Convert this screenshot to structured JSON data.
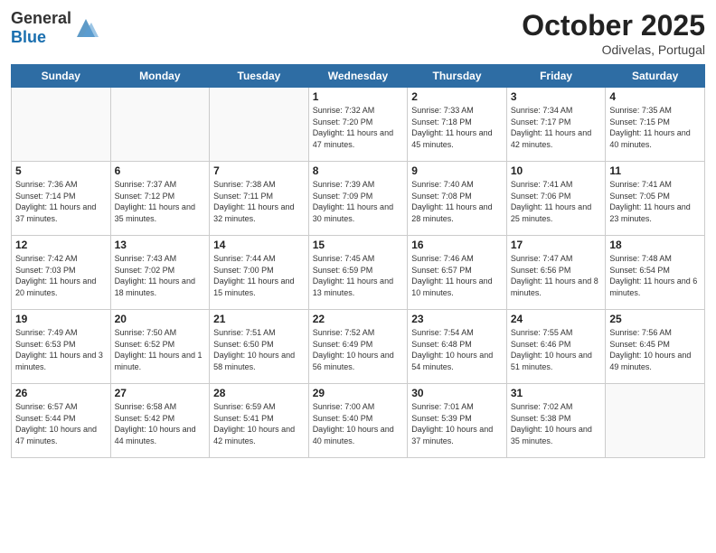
{
  "header": {
    "logo_general": "General",
    "logo_blue": "Blue",
    "title": "October 2025",
    "subtitle": "Odivelas, Portugal"
  },
  "days_of_week": [
    "Sunday",
    "Monday",
    "Tuesday",
    "Wednesday",
    "Thursday",
    "Friday",
    "Saturday"
  ],
  "weeks": [
    [
      {
        "day": "",
        "info": ""
      },
      {
        "day": "",
        "info": ""
      },
      {
        "day": "",
        "info": ""
      },
      {
        "day": "1",
        "info": "Sunrise: 7:32 AM\nSunset: 7:20 PM\nDaylight: 11 hours and 47 minutes."
      },
      {
        "day": "2",
        "info": "Sunrise: 7:33 AM\nSunset: 7:18 PM\nDaylight: 11 hours and 45 minutes."
      },
      {
        "day": "3",
        "info": "Sunrise: 7:34 AM\nSunset: 7:17 PM\nDaylight: 11 hours and 42 minutes."
      },
      {
        "day": "4",
        "info": "Sunrise: 7:35 AM\nSunset: 7:15 PM\nDaylight: 11 hours and 40 minutes."
      }
    ],
    [
      {
        "day": "5",
        "info": "Sunrise: 7:36 AM\nSunset: 7:14 PM\nDaylight: 11 hours and 37 minutes."
      },
      {
        "day": "6",
        "info": "Sunrise: 7:37 AM\nSunset: 7:12 PM\nDaylight: 11 hours and 35 minutes."
      },
      {
        "day": "7",
        "info": "Sunrise: 7:38 AM\nSunset: 7:11 PM\nDaylight: 11 hours and 32 minutes."
      },
      {
        "day": "8",
        "info": "Sunrise: 7:39 AM\nSunset: 7:09 PM\nDaylight: 11 hours and 30 minutes."
      },
      {
        "day": "9",
        "info": "Sunrise: 7:40 AM\nSunset: 7:08 PM\nDaylight: 11 hours and 28 minutes."
      },
      {
        "day": "10",
        "info": "Sunrise: 7:41 AM\nSunset: 7:06 PM\nDaylight: 11 hours and 25 minutes."
      },
      {
        "day": "11",
        "info": "Sunrise: 7:41 AM\nSunset: 7:05 PM\nDaylight: 11 hours and 23 minutes."
      }
    ],
    [
      {
        "day": "12",
        "info": "Sunrise: 7:42 AM\nSunset: 7:03 PM\nDaylight: 11 hours and 20 minutes."
      },
      {
        "day": "13",
        "info": "Sunrise: 7:43 AM\nSunset: 7:02 PM\nDaylight: 11 hours and 18 minutes."
      },
      {
        "day": "14",
        "info": "Sunrise: 7:44 AM\nSunset: 7:00 PM\nDaylight: 11 hours and 15 minutes."
      },
      {
        "day": "15",
        "info": "Sunrise: 7:45 AM\nSunset: 6:59 PM\nDaylight: 11 hours and 13 minutes."
      },
      {
        "day": "16",
        "info": "Sunrise: 7:46 AM\nSunset: 6:57 PM\nDaylight: 11 hours and 10 minutes."
      },
      {
        "day": "17",
        "info": "Sunrise: 7:47 AM\nSunset: 6:56 PM\nDaylight: 11 hours and 8 minutes."
      },
      {
        "day": "18",
        "info": "Sunrise: 7:48 AM\nSunset: 6:54 PM\nDaylight: 11 hours and 6 minutes."
      }
    ],
    [
      {
        "day": "19",
        "info": "Sunrise: 7:49 AM\nSunset: 6:53 PM\nDaylight: 11 hours and 3 minutes."
      },
      {
        "day": "20",
        "info": "Sunrise: 7:50 AM\nSunset: 6:52 PM\nDaylight: 11 hours and 1 minute."
      },
      {
        "day": "21",
        "info": "Sunrise: 7:51 AM\nSunset: 6:50 PM\nDaylight: 10 hours and 58 minutes."
      },
      {
        "day": "22",
        "info": "Sunrise: 7:52 AM\nSunset: 6:49 PM\nDaylight: 10 hours and 56 minutes."
      },
      {
        "day": "23",
        "info": "Sunrise: 7:54 AM\nSunset: 6:48 PM\nDaylight: 10 hours and 54 minutes."
      },
      {
        "day": "24",
        "info": "Sunrise: 7:55 AM\nSunset: 6:46 PM\nDaylight: 10 hours and 51 minutes."
      },
      {
        "day": "25",
        "info": "Sunrise: 7:56 AM\nSunset: 6:45 PM\nDaylight: 10 hours and 49 minutes."
      }
    ],
    [
      {
        "day": "26",
        "info": "Sunrise: 6:57 AM\nSunset: 5:44 PM\nDaylight: 10 hours and 47 minutes."
      },
      {
        "day": "27",
        "info": "Sunrise: 6:58 AM\nSunset: 5:42 PM\nDaylight: 10 hours and 44 minutes."
      },
      {
        "day": "28",
        "info": "Sunrise: 6:59 AM\nSunset: 5:41 PM\nDaylight: 10 hours and 42 minutes."
      },
      {
        "day": "29",
        "info": "Sunrise: 7:00 AM\nSunset: 5:40 PM\nDaylight: 10 hours and 40 minutes."
      },
      {
        "day": "30",
        "info": "Sunrise: 7:01 AM\nSunset: 5:39 PM\nDaylight: 10 hours and 37 minutes."
      },
      {
        "day": "31",
        "info": "Sunrise: 7:02 AM\nSunset: 5:38 PM\nDaylight: 10 hours and 35 minutes."
      },
      {
        "day": "",
        "info": ""
      }
    ]
  ]
}
